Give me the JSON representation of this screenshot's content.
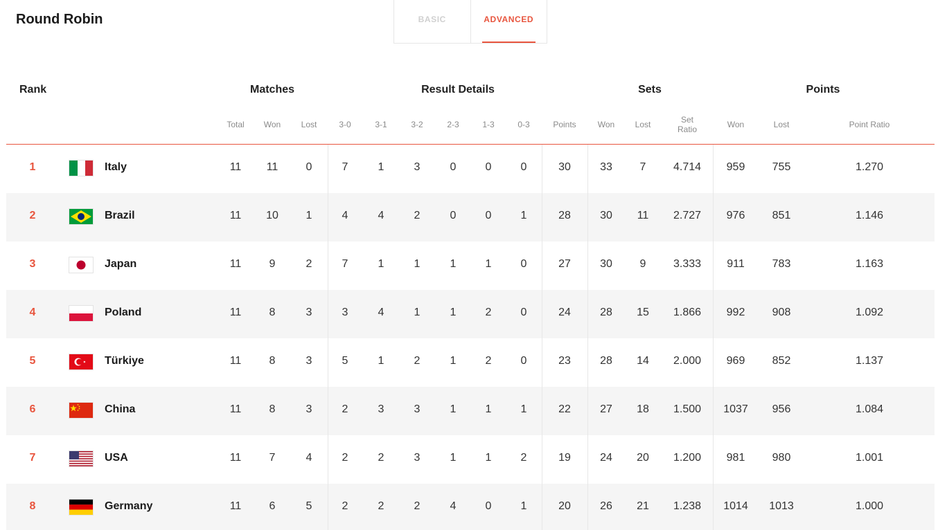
{
  "page": {
    "title": "Round Robin"
  },
  "tabs": [
    {
      "label": "BASIC",
      "active": false
    },
    {
      "label": "ADVANCED",
      "active": true
    }
  ],
  "colors": {
    "accent": "#e8553e",
    "row_alt": "#f5f5f5",
    "muted_text": "#8a8a8a"
  },
  "table": {
    "groups": {
      "rank": "Rank",
      "matches": "Matches",
      "result_details": "Result Details",
      "sets": "Sets",
      "points": "Points"
    },
    "subheaders": {
      "total": "Total",
      "won": "Won",
      "lost": "Lost",
      "r30": "3-0",
      "r31": "3-1",
      "r32": "3-2",
      "r23": "2-3",
      "r13": "1-3",
      "r03": "0-3",
      "points": "Points",
      "sets_won": "Won",
      "sets_lost": "Lost",
      "set_ratio_1": "Set",
      "set_ratio_2": "Ratio",
      "points_won": "Won",
      "points_lost": "Lost",
      "point_ratio": "Point Ratio"
    },
    "rows": [
      {
        "rank": "1",
        "team": "Italy",
        "flag": "italy-flag-icon",
        "total": "11",
        "won": "11",
        "lost": "0",
        "r30": "7",
        "r31": "1",
        "r32": "3",
        "r23": "0",
        "r13": "0",
        "r03": "0",
        "points": "30",
        "sets_won": "33",
        "sets_lost": "7",
        "set_ratio": "4.714",
        "points_won": "959",
        "points_lost": "755",
        "point_ratio": "1.270"
      },
      {
        "rank": "2",
        "team": "Brazil",
        "flag": "brazil-flag-icon",
        "total": "11",
        "won": "10",
        "lost": "1",
        "r30": "4",
        "r31": "4",
        "r32": "2",
        "r23": "0",
        "r13": "0",
        "r03": "1",
        "points": "28",
        "sets_won": "30",
        "sets_lost": "11",
        "set_ratio": "2.727",
        "points_won": "976",
        "points_lost": "851",
        "point_ratio": "1.146"
      },
      {
        "rank": "3",
        "team": "Japan",
        "flag": "japan-flag-icon",
        "total": "11",
        "won": "9",
        "lost": "2",
        "r30": "7",
        "r31": "1",
        "r32": "1",
        "r23": "1",
        "r13": "1",
        "r03": "0",
        "points": "27",
        "sets_won": "30",
        "sets_lost": "9",
        "set_ratio": "3.333",
        "points_won": "911",
        "points_lost": "783",
        "point_ratio": "1.163"
      },
      {
        "rank": "4",
        "team": "Poland",
        "flag": "poland-flag-icon",
        "total": "11",
        "won": "8",
        "lost": "3",
        "r30": "3",
        "r31": "4",
        "r32": "1",
        "r23": "1",
        "r13": "2",
        "r03": "0",
        "points": "24",
        "sets_won": "28",
        "sets_lost": "15",
        "set_ratio": "1.866",
        "points_won": "992",
        "points_lost": "908",
        "point_ratio": "1.092"
      },
      {
        "rank": "5",
        "team": "Türkiye",
        "flag": "turkiye-flag-icon",
        "total": "11",
        "won": "8",
        "lost": "3",
        "r30": "5",
        "r31": "1",
        "r32": "2",
        "r23": "1",
        "r13": "2",
        "r03": "0",
        "points": "23",
        "sets_won": "28",
        "sets_lost": "14",
        "set_ratio": "2.000",
        "points_won": "969",
        "points_lost": "852",
        "point_ratio": "1.137"
      },
      {
        "rank": "6",
        "team": "China",
        "flag": "china-flag-icon",
        "total": "11",
        "won": "8",
        "lost": "3",
        "r30": "2",
        "r31": "3",
        "r32": "3",
        "r23": "1",
        "r13": "1",
        "r03": "1",
        "points": "22",
        "sets_won": "27",
        "sets_lost": "18",
        "set_ratio": "1.500",
        "points_won": "1037",
        "points_lost": "956",
        "point_ratio": "1.084"
      },
      {
        "rank": "7",
        "team": "USA",
        "flag": "usa-flag-icon",
        "total": "11",
        "won": "7",
        "lost": "4",
        "r30": "2",
        "r31": "2",
        "r32": "3",
        "r23": "1",
        "r13": "1",
        "r03": "2",
        "points": "19",
        "sets_won": "24",
        "sets_lost": "20",
        "set_ratio": "1.200",
        "points_won": "981",
        "points_lost": "980",
        "point_ratio": "1.001"
      },
      {
        "rank": "8",
        "team": "Germany",
        "flag": "germany-flag-icon",
        "total": "11",
        "won": "6",
        "lost": "5",
        "r30": "2",
        "r31": "2",
        "r32": "2",
        "r23": "4",
        "r13": "0",
        "r03": "1",
        "points": "20",
        "sets_won": "26",
        "sets_lost": "21",
        "set_ratio": "1.238",
        "points_won": "1014",
        "points_lost": "1013",
        "point_ratio": "1.000"
      }
    ]
  }
}
